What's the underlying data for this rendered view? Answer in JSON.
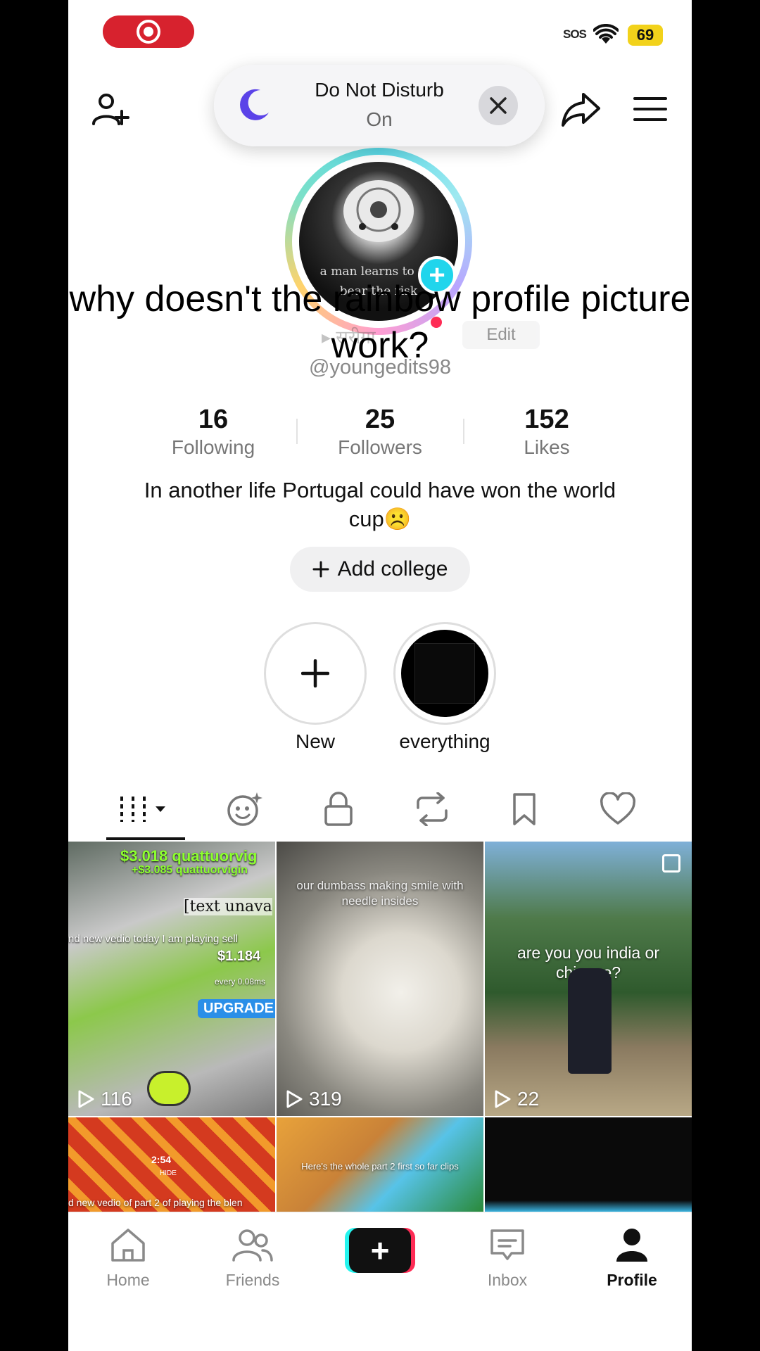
{
  "status_bar": {
    "sos": "SOS",
    "battery": "69"
  },
  "dnd_toast": {
    "title": "Do Not Disturb",
    "state": "On"
  },
  "overlay_caption": "why doesn't the rainbow profile picture work?",
  "avatar": {
    "caption": "a man learns to fell\nbear the risk"
  },
  "header_ghost": {
    "name": "▸ सरीगा",
    "edit": "Edit"
  },
  "profile": {
    "handle": "@youngedits98",
    "stats": [
      {
        "value": "16",
        "label": "Following"
      },
      {
        "value": "25",
        "label": "Followers"
      },
      {
        "value": "152",
        "label": "Likes"
      }
    ],
    "bio": "In another life Portugal could have won the world cup☹️",
    "add_college": "Add college"
  },
  "highlights": [
    {
      "label": "New"
    },
    {
      "label": "everything"
    }
  ],
  "tabs": [
    "videos-tab",
    "reposts-ai-tab",
    "private-tab",
    "repost-tab",
    "saved-tab",
    "liked-tab"
  ],
  "videos": [
    {
      "views": "116",
      "top": "$3.018 quattuorvig",
      "sub": "+$3.085 quattuorvigin",
      "mid": "[text unava",
      "line": "nd new vedio today I am playing sell",
      "price": "$1.184",
      "upgrade": "UPGRADE",
      "every": "every 0.08ms"
    },
    {
      "views": "319",
      "overlay": "our dumbass making smile with needle insides"
    },
    {
      "views": "22",
      "overlay": "are you you india or chinese?"
    },
    {
      "overlay": "d new vedio of part 2 of playing the blen",
      "time": "2:54",
      "hide": "HIDE"
    },
    {
      "overlay": "Here's the whole part 2 first so far clips"
    },
    {}
  ],
  "bottom_nav": [
    {
      "label": "Home"
    },
    {
      "label": "Friends"
    },
    {
      "label": "Inbox"
    },
    {
      "label": "Profile"
    }
  ],
  "colors": {
    "accent_red": "#fe2c55",
    "accent_cyan": "#25f4ee",
    "dnd_moon": "#5b43e8",
    "record_red": "#d7222e"
  }
}
